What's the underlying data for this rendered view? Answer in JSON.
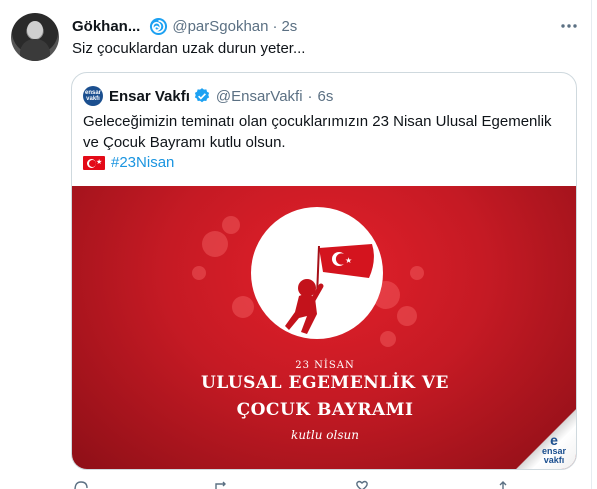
{
  "tweet": {
    "author_name": "Gökhan...",
    "author_handle": "@parSgokhan",
    "separator": "·",
    "time": "2s",
    "text": "Siz çocuklardan uzak durun yeter...",
    "badge_icon": "spiral-badge-icon",
    "more_icon": "more-options-icon"
  },
  "quote": {
    "author_name": "Ensar Vakfı",
    "author_handle": "@EnsarVakfi",
    "separator": "·",
    "time": "6s",
    "avatar_text_top": "ensar",
    "avatar_text_bottom": "vakfı",
    "verified_icon": "verified-badge-icon",
    "text": "Geleceğimizin teminatı olan çocuklarımızın 23 Nisan Ulusal Egemenlik ve Çocuk Bayramı kutlu olsun.",
    "hashtag": "#23Nisan",
    "flag_icon": "turkish-flag-icon",
    "banner": {
      "line1": "23 NİSAN",
      "line2": "ULUSAL EGEMENLİK VE",
      "line3": "ÇOCUK BAYRAMI",
      "line4": "kutlu olsun",
      "logo_top": "e",
      "logo_mid": "ensar",
      "logo_bottom": "vakfı"
    }
  },
  "actions": [
    "reply-icon",
    "retweet-icon",
    "like-icon",
    "share-icon"
  ],
  "colors": {
    "accent": "#1da1f2",
    "banner_red": "#c51a24",
    "text_secondary": "#5b7083"
  }
}
